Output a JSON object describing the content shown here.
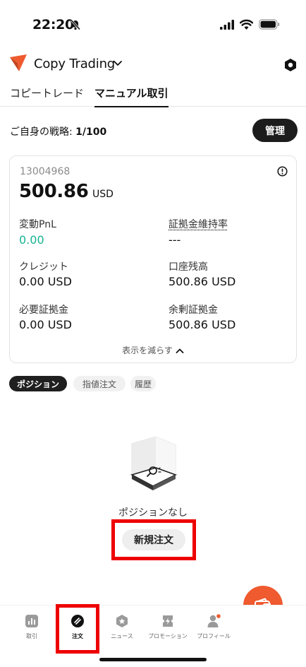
{
  "status_bar": {
    "time": "22:20"
  },
  "header": {
    "title": "Copy Trading"
  },
  "tabs": [
    {
      "label": "コピートレード",
      "active": false
    },
    {
      "label": "マニュアル取引",
      "active": true
    }
  ],
  "strategy": {
    "label": "ご自身の戦略:",
    "value": "1/100",
    "manage_label": "管理"
  },
  "account": {
    "id": "13004968",
    "balance": "500.86",
    "currency": "USD",
    "metrics": [
      {
        "label": "変動PnL",
        "value": "0.00"
      },
      {
        "label": "証拠金維持率",
        "value": "---"
      },
      {
        "label": "クレジット",
        "value": "0.00 USD"
      },
      {
        "label": "口座残高",
        "value": "500.86 USD"
      },
      {
        "label": "必要証拠金",
        "value": "0.00 USD"
      },
      {
        "label": "余剰証拠金",
        "value": "500.86 USD"
      }
    ],
    "collapse_label": "表示を減らす"
  },
  "position_tabs": [
    {
      "label": "ポジション",
      "active": true
    },
    {
      "label": "指値注文",
      "active": false
    },
    {
      "label": "履歴",
      "active": false
    }
  ],
  "empty_state": {
    "text": "ポジションなし",
    "button_label": "新規注文"
  },
  "bottom_nav": [
    {
      "label": "取引",
      "icon": "chart-icon",
      "active": false
    },
    {
      "label": "注文",
      "icon": "order-icon",
      "active": true
    },
    {
      "label": "ニュース",
      "icon": "news-icon",
      "active": false
    },
    {
      "label": "プロモーション",
      "icon": "promotion-icon",
      "active": false
    },
    {
      "label": "プロフィール",
      "icon": "profile-icon",
      "active": false
    }
  ],
  "colors": {
    "accent": "#ef5a2f",
    "positive": "#19b394",
    "highlight_box": "#ee0000"
  }
}
